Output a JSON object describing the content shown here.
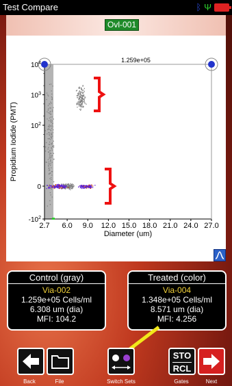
{
  "window": {
    "title": "Test Compare"
  },
  "status_icons": [
    "bluetooth-icon",
    "usb-icon",
    "battery-icon"
  ],
  "sample": {
    "label": "Ovl-001"
  },
  "chart_data": {
    "type": "scatter",
    "xlabel": "Diameter (um)",
    "ylabel": "Propidium Iodide (PMT)",
    "x_ticks": [
      "2.7",
      "6.0",
      "9.0",
      "12.0",
      "15.0",
      "18.0",
      "21.0",
      "24.0",
      "27.0"
    ],
    "y_ticks": [
      "10^4",
      "10^3",
      "10^2",
      "0",
      "-10^2"
    ],
    "xlim": [
      2.7,
      27.0
    ],
    "gate_value_label": "1.259e+05",
    "series": [
      {
        "color": "#808080",
        "clusters": [
          {
            "x": 8.0,
            "y": 800,
            "spread_x": 0.9,
            "spread_y": 0.25
          },
          {
            "x": 6.0,
            "y": 0,
            "spread_x": 1.2,
            "spread_y": 0.15
          },
          {
            "x": 3.5,
            "y": 30,
            "spread_x": 0.8,
            "spread_y": 1.4
          }
        ]
      },
      {
        "color": "#5a1fd6",
        "clusters": [
          {
            "x": 4.5,
            "y": 0,
            "spread_x": 1.8,
            "spread_y": 0.1
          },
          {
            "x": 8.8,
            "y": 0,
            "spread_x": 1.6,
            "spread_y": 0.08
          }
        ]
      }
    ],
    "colors": {
      "gate_fill": "#b4b4b4",
      "gate_handle": "#2233cc",
      "bracket": "#ee1111"
    }
  },
  "control": {
    "title": "Control (gray)",
    "via": "Via-002",
    "cells": "1.259e+05 Cells/ml",
    "dia": "6.308 um (dia)",
    "mfi": "MFI: 104.2"
  },
  "treated": {
    "title": "Treated (color)",
    "via": "Via-004",
    "cells": "1.348e+05 Cells/ml",
    "dia": "8.571 um (dia)",
    "mfi": "MFI: 4.256"
  },
  "toolbar": {
    "back": "Back",
    "file": "File",
    "switch_sets": "Switch Sets",
    "gates": "Gates",
    "next": "Next",
    "sto": "STO",
    "rcl": "RCL"
  },
  "colors": {
    "accent_yellow": "#f2e81a",
    "badge_green": "#1f8b2a"
  }
}
